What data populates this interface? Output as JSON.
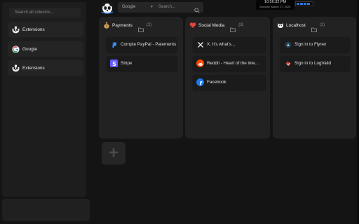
{
  "left_panel": {
    "search_placeholder": "Search all columns...",
    "items": [
      {
        "label": "Extensions",
        "icon": "panda-icon"
      },
      {
        "label": "Google",
        "icon": "google-icon"
      },
      {
        "label": "Extensions",
        "icon": "panda-icon"
      }
    ]
  },
  "topbar": {
    "engine": "Google",
    "search_placeholder": "Search...",
    "clock_time": "10:56:32 PM",
    "clock_date": "Monday, March 17, 2025"
  },
  "columns": [
    {
      "title": "Payments",
      "count": "(2)",
      "icon": "money-bag-icon",
      "cards": [
        {
          "label": "Compte PayPal - Paiements",
          "icon": "paypal-icon"
        },
        {
          "label": "Stripe",
          "icon": "stripe-icon"
        }
      ]
    },
    {
      "title": "Social Media",
      "count": "(3)",
      "icon": "heart-icon",
      "cards": [
        {
          "label": "X. It's what's...",
          "icon": "x-icon"
        },
        {
          "label": "Reddit - Heart of the inte...",
          "icon": "reddit-icon"
        },
        {
          "label": "Facebook",
          "icon": "facebook-icon"
        }
      ]
    },
    {
      "title": "Localhost",
      "count": "(2)",
      "icon": "cat-face-icon",
      "cards": [
        {
          "label": "Sign in to Flyner",
          "icon": "flyner-icon"
        },
        {
          "label": "Sign in to LogValid",
          "icon": "logvalid-icon"
        }
      ]
    }
  ],
  "add_column": {
    "label": "+"
  },
  "colors": {
    "background": "#141414",
    "panel": "#222222",
    "accent": "#2c74d6"
  }
}
